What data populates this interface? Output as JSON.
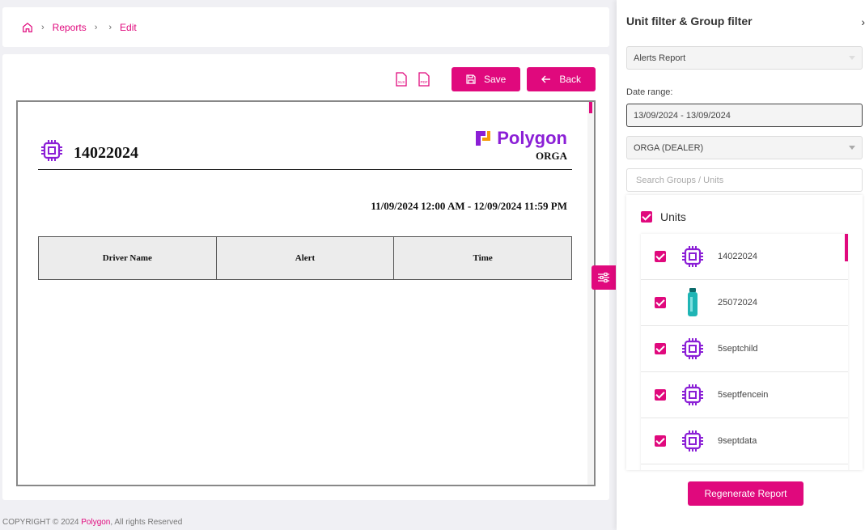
{
  "breadcrumb": {
    "items": [
      "Reports",
      "Edit"
    ]
  },
  "toolbar": {
    "save_label": "Save",
    "back_label": "Back",
    "xls_badge": "XLS",
    "pdf_badge": "PDF"
  },
  "report": {
    "unit_title": "14022024",
    "brand_name": "Polygon",
    "brand_sub": "ORGA",
    "date_range": "11/09/2024 12:00 AM - 12/09/2024 11:59 PM",
    "columns": [
      "Driver Name",
      "Alert",
      "Time"
    ]
  },
  "footer": {
    "prefix": "COPYRIGHT © 2024",
    "brand": "Polygon",
    "suffix": ", All rights Reserved"
  },
  "panel": {
    "title": "Unit filter & Group filter",
    "report_type": "Alerts Report",
    "date_label": "Date range:",
    "date_value": "13/09/2024 - 13/09/2024",
    "org": "ORGA (DEALER)",
    "search_placeholder": "Search Groups / Units",
    "units_label": "Units",
    "units": [
      {
        "name": "14022024",
        "icon": "chip-icon"
      },
      {
        "name": "25072024",
        "icon": "bottle-icon"
      },
      {
        "name": "5septchild",
        "icon": "chip-icon"
      },
      {
        "name": "5septfencein",
        "icon": "chip-icon"
      },
      {
        "name": "9septdata",
        "icon": "chip-icon"
      }
    ],
    "regenerate_label": "Regenerate Report"
  },
  "colors": {
    "accent": "#e0097d",
    "brand": "#8b1fd6",
    "teal": "#1fb5b5"
  }
}
